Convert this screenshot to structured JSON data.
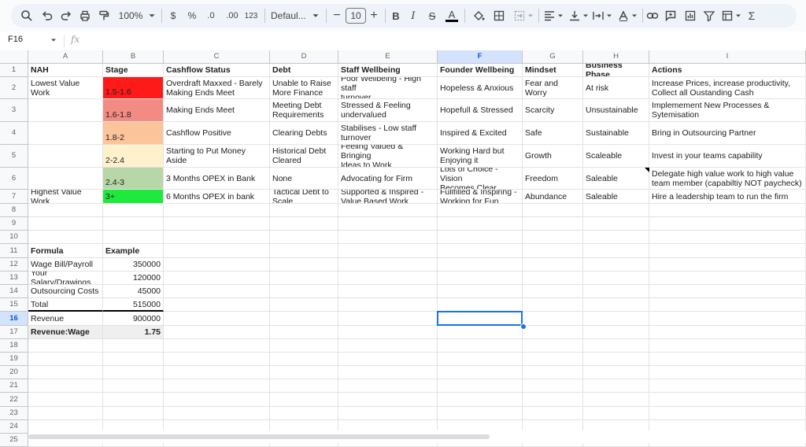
{
  "toolbar": {
    "zoom": "100%",
    "currency": "$",
    "percent": "%",
    "decrease_decimals": ".0",
    "increase_decimals": ".00",
    "number_format": "123",
    "font_family": "Defaul...",
    "font_size": "10",
    "minus": "−",
    "plus": "+",
    "bold": "B",
    "italic": "I",
    "strike": "S",
    "text_color": "A",
    "function": "Σ"
  },
  "name_box": "F16",
  "fx_label": "fx",
  "columns": [
    "A",
    "B",
    "C",
    "D",
    "E",
    "F",
    "G",
    "H",
    "I"
  ],
  "selected_column": "F",
  "selected_row": "16",
  "rows": [
    "1",
    "2",
    "3",
    "4",
    "5",
    "6",
    "7",
    "8",
    "9",
    "10",
    "11",
    "12",
    "13",
    "14",
    "15",
    "16",
    "17",
    "18",
    "19",
    "20",
    "21",
    "22",
    "23",
    "24",
    "25"
  ],
  "header_row": {
    "a": "NAH",
    "b": "Stage",
    "c": "Cashflow Status",
    "d": "Debt",
    "e": "Staff Wellbeing",
    "f": "Founder Wellbeing",
    "g": "Mindset",
    "h": "Business Phase",
    "i": "Actions"
  },
  "stage_rows": [
    {
      "a": "Lowest Value Work",
      "b": "1.5-1.6",
      "color": "#ff1a1a",
      "c": "Overdraft Maxxed - Barely\nMaking Ends Meet",
      "d": "Unable to Raise\nMore Finance",
      "e": "Poor Wellbeing - High staff\nturnover",
      "f": "Hopeless & Anxious",
      "g": "Fear and Worry",
      "h": "At risk",
      "i": "Increase Prices, increase productivity,\nCollect all Oustanding Cash"
    },
    {
      "a": "",
      "b": "1.6-1.8",
      "color": "#f28b82",
      "c": "Making Ends Meet",
      "d": "Meeting Debt\nRequirements",
      "e": "Stressed & Feeling\nundervalued",
      "f": "Hopefull & Stressed",
      "g": "Scarcity",
      "h": "Unsustainable",
      "i": "Implemement New Processes &\nSytemisation"
    },
    {
      "a": "",
      "b": "1.8-2",
      "color": "#fcc49b",
      "c": "Cashflow Positive",
      "d": "Clearing Debts",
      "e": "Stabilises - Low staff\nturnover",
      "f": "Inspired & Excited",
      "g": "Safe",
      "h": "Sustainable",
      "i": "Bring in Outsourcing Partner"
    },
    {
      "a": "",
      "b": "2-2.4",
      "color": "#fff1cc",
      "c": "Starting to Put Money Aside",
      "d": "Historical Debt\nCleared",
      "e": "Feeling Valued & Bringing\nIdeas to Work",
      "f": "Working Hard but\nEnjoying it",
      "g": "Growth",
      "h": "Scaleable",
      "i": "Invest in your teams capability"
    },
    {
      "a": "",
      "b": "2.4-3",
      "color": "#b7d7a8",
      "c": "3 Months OPEX in Bank",
      "d": "None",
      "e": "Advocating for Firm",
      "f": "Lots of Choice - Vision\nBecomes Clear",
      "g": "Freedom",
      "h": "Saleable",
      "i": "Delegate high value work to high value\nteam member (capabiltiy NOT paycheck)"
    },
    {
      "a": "Highest Value Work",
      "b": "3+",
      "color": "#1dea3c",
      "c": "6 Months OPEX in bank",
      "d": "Tactical Debt to\nScale",
      "e": "Supported & Inspired -\nValue Based Work",
      "f": "Fullfilled & Inspiring -\nWorking for Fun",
      "g": "Abundance",
      "h": "Saleable",
      "i": "Hire a leadership team to run the firm"
    }
  ],
  "formula_table": {
    "header": {
      "label": "Formula",
      "value": "Example"
    },
    "rows": [
      {
        "label": "Wage Bill/Payroll",
        "value": "350000"
      },
      {
        "label": "Your Salary/Drawings",
        "value": "120000"
      },
      {
        "label": "Outsourcing Costs",
        "value": "45000"
      },
      {
        "label": "Total",
        "value": "515000"
      },
      {
        "label": "Revenue",
        "value": "900000"
      },
      {
        "label": "Revenue:Wage",
        "value": "1.75"
      }
    ]
  }
}
